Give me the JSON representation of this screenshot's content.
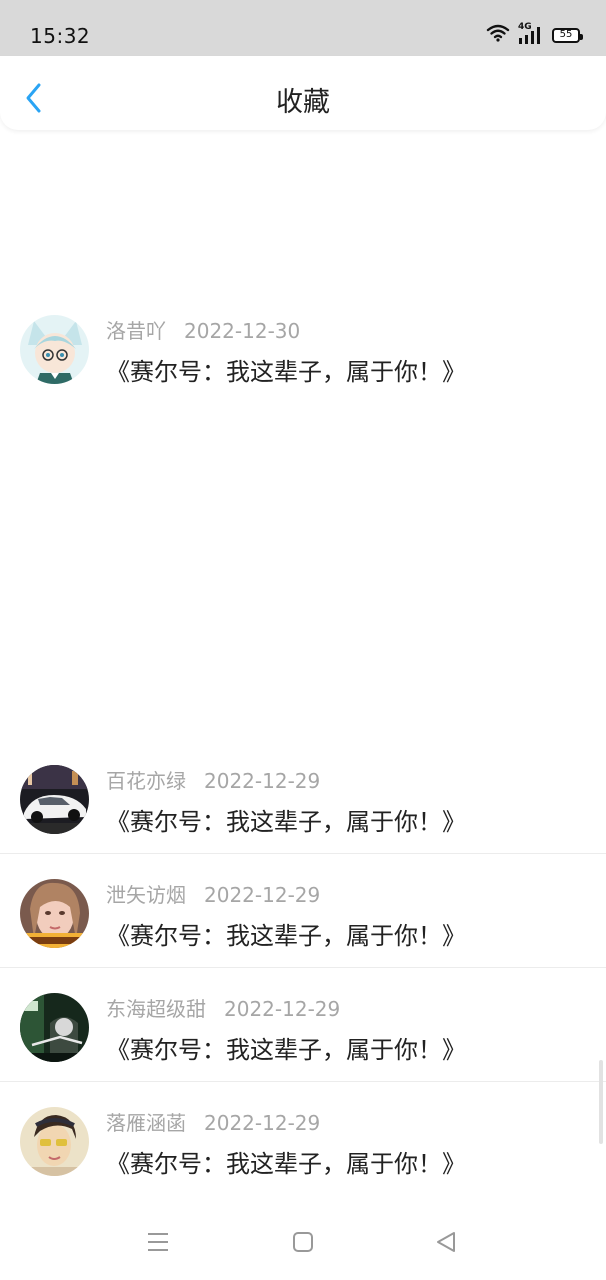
{
  "status_bar": {
    "time": "15:32",
    "network": "4G",
    "battery": "55"
  },
  "header": {
    "title": "收藏",
    "back_icon": "chevron-left-icon"
  },
  "items": [
    {
      "user": "洛昔吖",
      "date": "2022-12-30",
      "title": "《赛尔号：我这辈子，属于你！》",
      "avatar": "anime-avatar"
    },
    {
      "user": "百花亦绿",
      "date": "2022-12-29",
      "title": "《赛尔号：我这辈子，属于你！》",
      "avatar": "car-avatar"
    },
    {
      "user": "泄矢访烟",
      "date": "2022-12-29",
      "title": "《赛尔号：我这辈子，属于你！》",
      "avatar": "portrait-avatar"
    },
    {
      "user": "东海超级甜",
      "date": "2022-12-29",
      "title": "《赛尔号：我这辈子，属于你！》",
      "avatar": "dark-avatar"
    },
    {
      "user": "落雁涵菡",
      "date": "2022-12-29",
      "title": "《赛尔号：我这辈子，属于你！》",
      "avatar": "portrait-avatar-2"
    }
  ],
  "nav_bar": {
    "menu_icon": "menu-icon",
    "home_icon": "home-square-icon",
    "back_icon": "back-triangle-icon"
  },
  "colors": {
    "accent": "#2aa4f4",
    "status_bar_bg": "#d9d9d9",
    "meta_text": "#a6a6a6",
    "title_text": "#222222"
  }
}
